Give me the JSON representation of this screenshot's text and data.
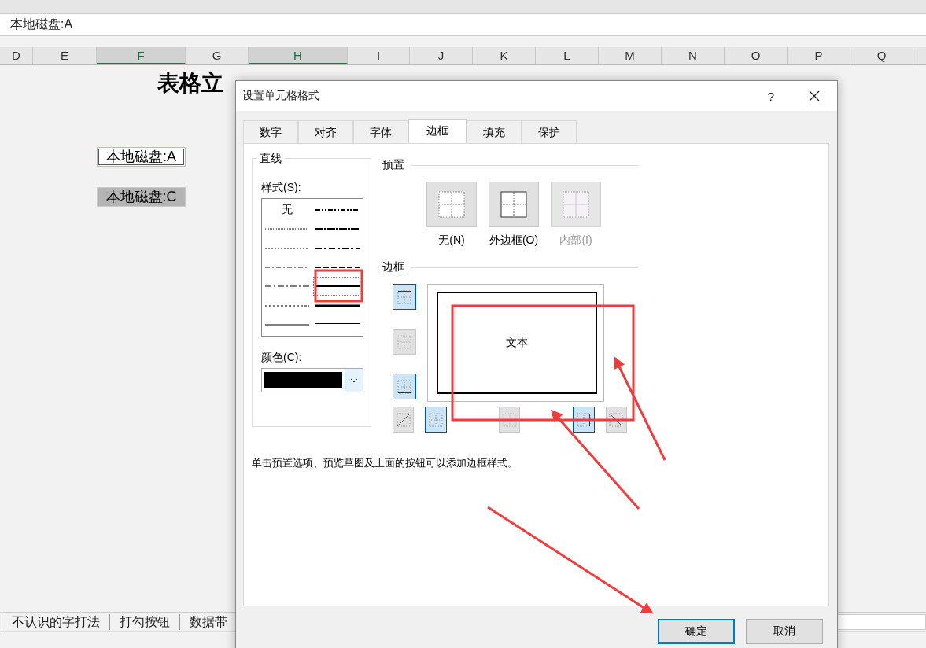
{
  "formula_bar": {
    "value": "本地磁盘:A"
  },
  "columns": [
    {
      "label": "D",
      "selected": false
    },
    {
      "label": "E",
      "selected": false
    },
    {
      "label": "F",
      "selected": true
    },
    {
      "label": "G",
      "selected": false
    },
    {
      "label": "H",
      "selected": true
    },
    {
      "label": "I",
      "selected": false
    },
    {
      "label": "J",
      "selected": false
    },
    {
      "label": "K",
      "selected": false
    },
    {
      "label": "L",
      "selected": false
    },
    {
      "label": "M",
      "selected": false
    },
    {
      "label": "N",
      "selected": false
    },
    {
      "label": "O",
      "selected": false
    },
    {
      "label": "P",
      "selected": false
    },
    {
      "label": "Q",
      "selected": false
    }
  ],
  "sheet": {
    "title": "表格立",
    "cells": [
      {
        "text": "本地磁盘:A",
        "kind": "active"
      },
      {
        "text": "本地磁盘:C",
        "kind": "filled"
      }
    ]
  },
  "sheet_tabs": [
    "不认识的字打法",
    "打勾按钮",
    "数据带"
  ],
  "dialog": {
    "title": "设置单元格格式",
    "help": "?",
    "tabs": [
      {
        "label": "数字",
        "selected": false
      },
      {
        "label": "对齐",
        "selected": false
      },
      {
        "label": "字体",
        "selected": false
      },
      {
        "label": "边框",
        "selected": true
      },
      {
        "label": "填充",
        "selected": false
      },
      {
        "label": "保护",
        "selected": false
      }
    ],
    "line": {
      "title": "直线",
      "style_label": "样式(S):",
      "styles": [
        {
          "kind": "none",
          "label": "无",
          "selected": false
        },
        {
          "kind": "hair",
          "selected": false
        },
        {
          "kind": "dotted",
          "selected": false
        },
        {
          "kind": "dash-dot-dot",
          "selected": false
        },
        {
          "kind": "dash-dot",
          "selected": false
        },
        {
          "kind": "dashed",
          "selected": false
        },
        {
          "kind": "thin",
          "selected": false
        },
        {
          "kind": "medium-dash-dot-dot",
          "selected": false
        },
        {
          "kind": "slant-dash-dot",
          "selected": false
        },
        {
          "kind": "medium-dash-dot",
          "selected": false
        },
        {
          "kind": "medium-dashed",
          "selected": false
        },
        {
          "kind": "medium",
          "selected": true
        },
        {
          "kind": "thick",
          "selected": false
        },
        {
          "kind": "double",
          "selected": false
        }
      ],
      "color_label": "颜色(C):",
      "color": "#000000"
    },
    "presets": {
      "title": "预置",
      "items": [
        {
          "label": "无(N)",
          "kind": "none",
          "disabled": false
        },
        {
          "label": "外边框(O)",
          "kind": "outline",
          "disabled": false
        },
        {
          "label": "内部(I)",
          "kind": "inside",
          "disabled": true
        }
      ]
    },
    "border": {
      "title": "边框",
      "preview_text": "文本",
      "side_buttons": [
        {
          "kind": "top",
          "on": true,
          "disabled": false
        },
        {
          "kind": "inside-h",
          "on": false,
          "disabled": true
        },
        {
          "kind": "bottom",
          "on": true,
          "disabled": false
        }
      ],
      "bottom_buttons": [
        {
          "kind": "diag-up",
          "on": false,
          "disabled": false
        },
        {
          "kind": "left",
          "on": true,
          "disabled": false
        },
        {
          "kind": "inside-v",
          "on": false,
          "disabled": true
        },
        {
          "kind": "right",
          "on": true,
          "disabled": false
        },
        {
          "kind": "diag-down",
          "on": false,
          "disabled": false
        }
      ]
    },
    "hint": "单击预置选项、预览草图及上面的按钮可以添加边框样式。",
    "buttons": [
      {
        "label": "确定",
        "default": true
      },
      {
        "label": "取消",
        "default": false
      }
    ]
  }
}
